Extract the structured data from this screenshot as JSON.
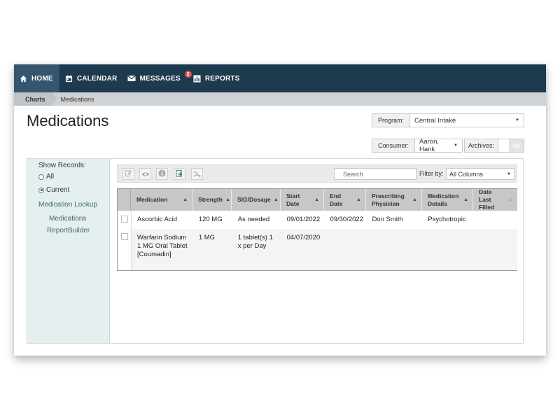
{
  "nav": {
    "items": [
      {
        "label": "HOME",
        "icon": "home-icon"
      },
      {
        "label": "CALENDAR",
        "icon": "calendar-icon"
      },
      {
        "label": "MESSAGES",
        "icon": "mail-icon",
        "badge": "2"
      },
      {
        "label": "REPORTS",
        "icon": "bar-chart-icon"
      }
    ]
  },
  "breadcrumb": {
    "items": [
      "Charts",
      "Medications"
    ]
  },
  "page": {
    "title": "Medications"
  },
  "program": {
    "label": "Program:",
    "value": "Central Intake"
  },
  "consumer": {
    "label": "Consumer:",
    "value": "Aaron, Hank"
  },
  "archives": {
    "label": "Archives:",
    "value": "No"
  },
  "sidebar": {
    "show_records": "Show Records:",
    "options": [
      "All",
      "Current"
    ],
    "selected": "Current",
    "links": [
      "Medication Lookup",
      "Medications",
      "ReportBuilder"
    ]
  },
  "toolbar": {
    "buttons": [
      "edit-icon",
      "view-icon",
      "info-icon",
      "add-icon",
      "forward-icon"
    ],
    "search_placeholder": "Search",
    "filter_label": "Filter by:",
    "filter_value": "All Columns"
  },
  "table": {
    "columns": [
      "Medication",
      "Strength",
      "SIG/Dosage",
      "Start Date",
      "End Date",
      "Prescribing Physician",
      "Medication Details",
      "Date Last Filled"
    ],
    "rows": [
      [
        "Ascorbic Acid",
        "120 MG",
        "As needed",
        "09/01/2022",
        "09/30/2022",
        "Don Smith",
        "Psychotropic",
        ""
      ],
      [
        "Warfarin Sodium 1 MG Oral Tablet [Coumadin]",
        "1 MG",
        "1 tablet(s) 1 x per Day",
        "04/07/2020",
        "",
        "",
        "",
        ""
      ]
    ]
  },
  "colors": {
    "nav_bg": "#1d3a4f",
    "nav_active": "#35566e",
    "badge": "#d9534f",
    "sidebar_bg": "#e6efef",
    "link": "#3e6e5a"
  }
}
